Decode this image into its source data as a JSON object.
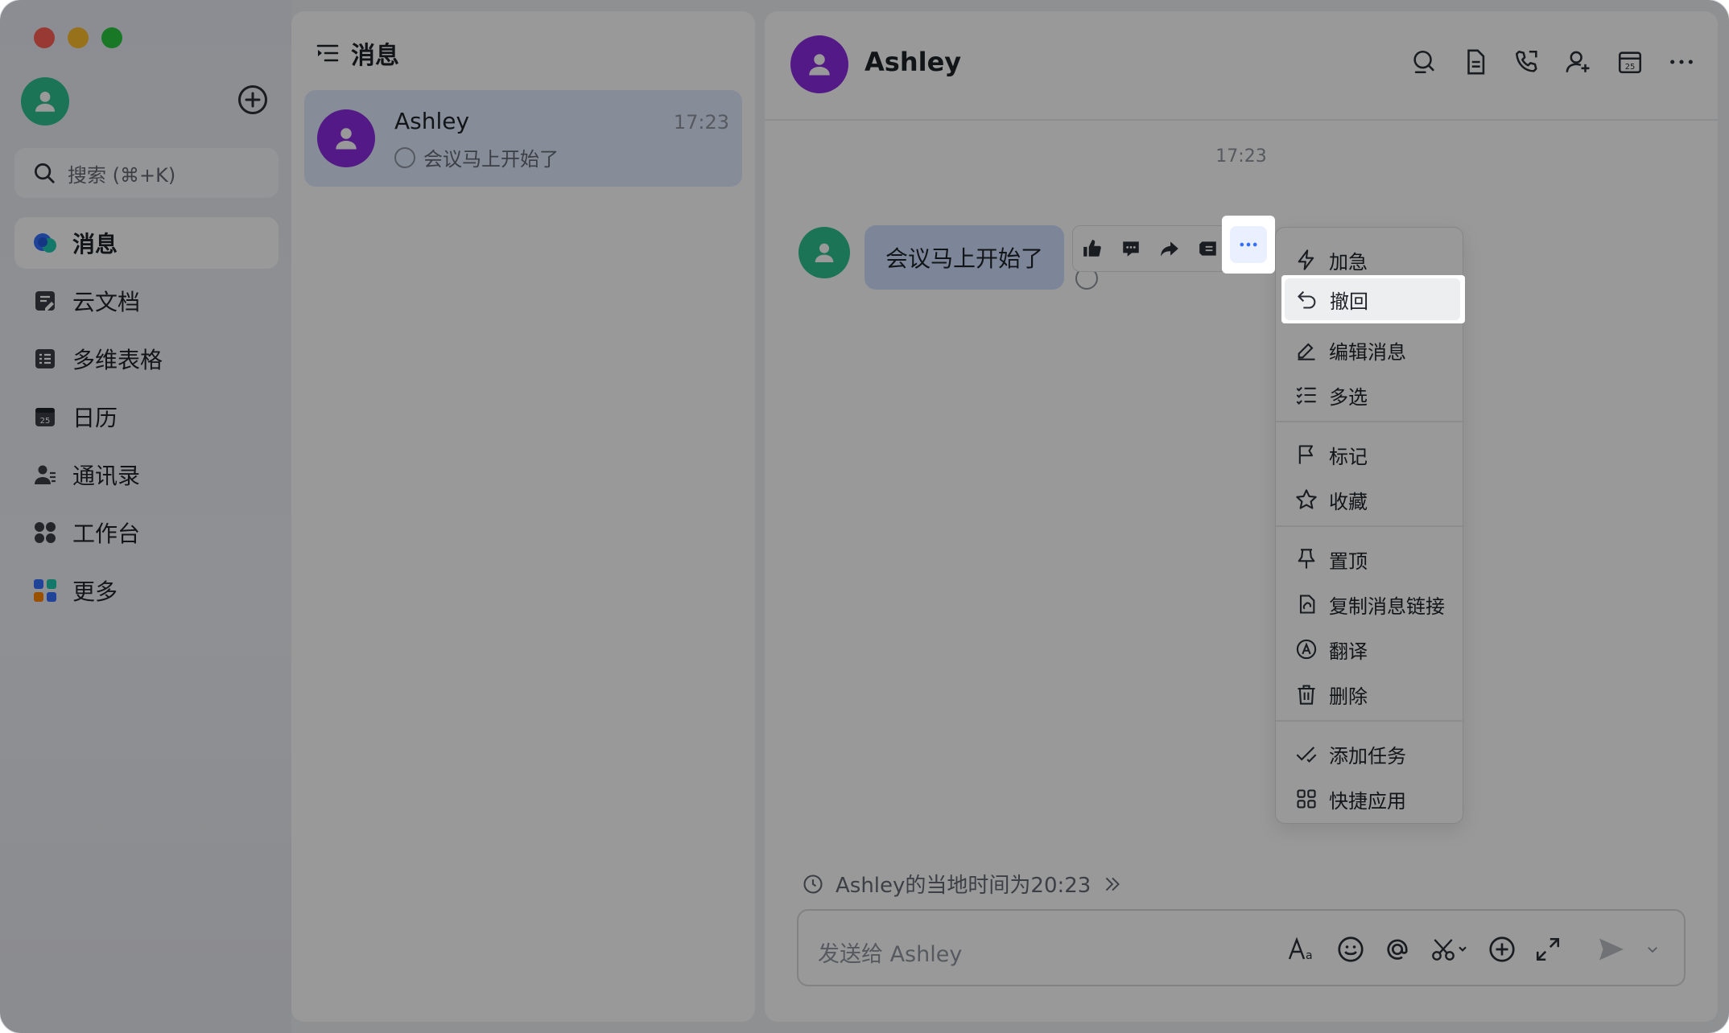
{
  "sidebar": {
    "search_placeholder": "搜索 (⌘+K)",
    "nav": [
      {
        "label": "消息",
        "icon": "chat-bubble-icon",
        "active": true
      },
      {
        "label": "云文档",
        "icon": "docs-icon"
      },
      {
        "label": "多维表格",
        "icon": "base-table-icon"
      },
      {
        "label": "日历",
        "icon": "calendar-icon"
      },
      {
        "label": "通讯录",
        "icon": "contacts-icon"
      },
      {
        "label": "工作台",
        "icon": "workplace-icon"
      },
      {
        "label": "更多",
        "icon": "more-apps-icon"
      }
    ]
  },
  "chat_list": {
    "title": "消息",
    "items": [
      {
        "name": "Ashley",
        "time": "17:23",
        "preview": "会议马上开始了"
      }
    ]
  },
  "chat": {
    "contact_name": "Ashley",
    "timestamp": "17:23",
    "message_text": "会议马上开始了",
    "timezone_note": "Ashley的当地时间为20:23",
    "composer_placeholder": "发送给 Ashley"
  },
  "context_menu": {
    "items": [
      {
        "label": "加急",
        "icon": "lightning-icon"
      },
      {
        "label": "撤回",
        "icon": "undo-icon",
        "highlighted": true
      },
      {
        "label": "编辑消息",
        "icon": "edit-icon"
      },
      {
        "label": "多选",
        "icon": "checklist-icon"
      },
      {
        "label": "标记",
        "icon": "flag-icon"
      },
      {
        "label": "收藏",
        "icon": "star-icon"
      },
      {
        "label": "置顶",
        "icon": "pin-icon"
      },
      {
        "label": "复制消息链接",
        "icon": "link-icon"
      },
      {
        "label": "翻译",
        "icon": "translate-icon"
      },
      {
        "label": "删除",
        "icon": "trash-icon"
      },
      {
        "label": "添加任务",
        "icon": "task-icon"
      },
      {
        "label": "快捷应用",
        "icon": "apps-grid-icon"
      }
    ]
  },
  "colors": {
    "accent": "#3370ff",
    "avatar_green": "#2fc191",
    "avatar_purple": "#8a2be2",
    "bubble": "#d1dfff"
  }
}
